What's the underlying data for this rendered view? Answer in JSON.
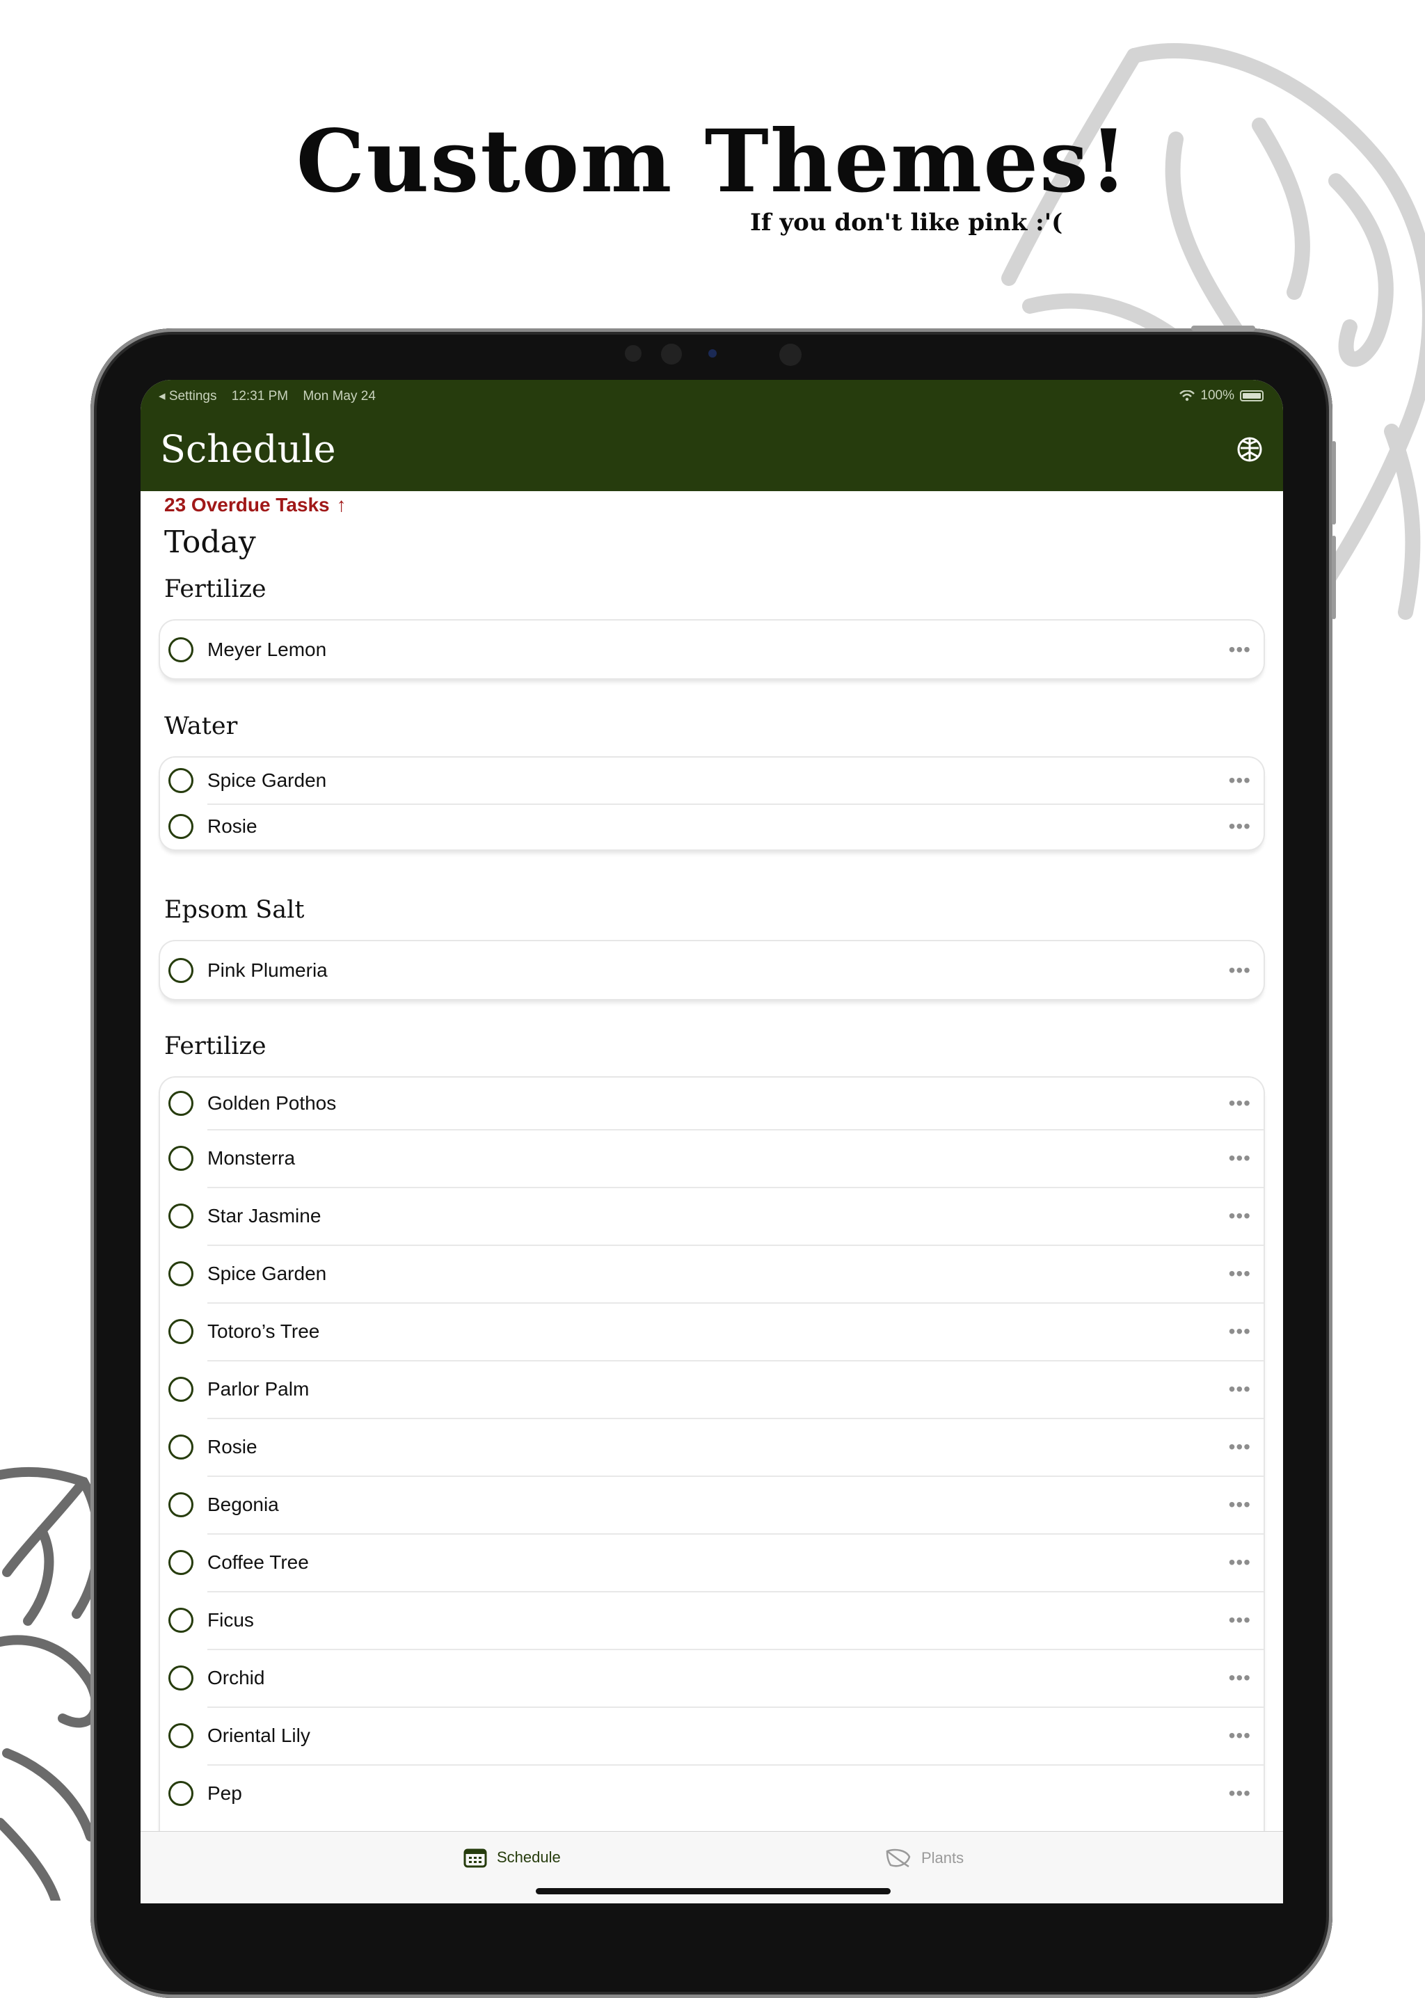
{
  "promo": {
    "title": "Custom Themes!",
    "subtitle": "If you don't like pink :'("
  },
  "colors": {
    "theme_primary": "#263c0d",
    "overdue_red": "#a01818",
    "checkbox": "#263c0d",
    "decoration_light": "#d4d4d4",
    "decoration_dark": "#6b6b6b"
  },
  "status_bar": {
    "back_app": "◂ Settings",
    "time": "12:31 PM",
    "date": "Mon May 24",
    "battery": "100%"
  },
  "nav": {
    "title": "Schedule",
    "icon": "monstera-leaf-icon"
  },
  "overdue": {
    "label": "23 Overdue Tasks",
    "arrow": "↑"
  },
  "today_heading": "Today",
  "groups": [
    {
      "title": "Fertilize",
      "items": [
        "Meyer Lemon"
      ]
    },
    {
      "title": "Water",
      "items": [
        "Spice Garden",
        "Rosie"
      ]
    },
    {
      "title": "Epsom Salt",
      "items": [
        "Pink Plumeria"
      ]
    },
    {
      "title": "Fertilize",
      "items": [
        "Golden Pothos",
        "Monsterra",
        "Star Jasmine",
        "Spice Garden",
        "Totoro’s Tree",
        "Parlor Palm",
        "Rosie",
        "Begonia",
        "Coffee Tree",
        "Ficus",
        "Orchid",
        "Oriental Lily",
        "Pep"
      ]
    }
  ],
  "row_menu": "•••",
  "tabs": [
    {
      "label": "Schedule",
      "icon": "calendar-icon",
      "selected": true
    },
    {
      "label": "Plants",
      "icon": "leaf-icon",
      "selected": false
    }
  ]
}
